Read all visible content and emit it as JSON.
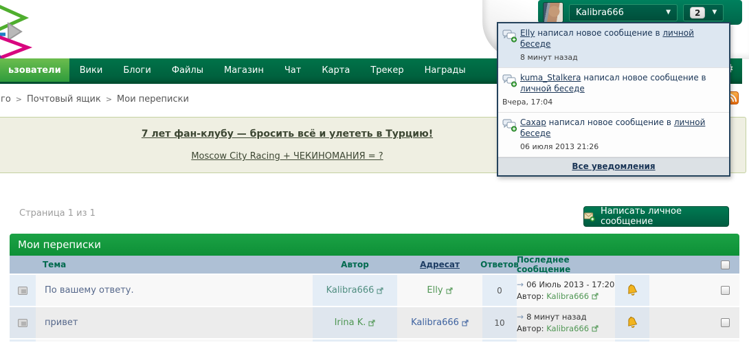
{
  "colors": {
    "nav_green": "#006a45",
    "accent_green": "#0e9037",
    "user_bar_teal": "#007455",
    "table_header_blue": "#aec0d5",
    "unread_blue": "#dde7f1",
    "link_green": "#4f9653",
    "link_blue": "#3f63a0",
    "announcement_bg": "#efefe2"
  },
  "user_bar": {
    "username": "Kalibra666",
    "notification_count": "2"
  },
  "notifications": {
    "items": [
      {
        "user": "Elly",
        "action": "написал новое сообщение в",
        "target": "личной беседе",
        "time": "8 минут назад"
      },
      {
        "user": "kuma_Stalkera",
        "action": "написал новое сообщение в",
        "target": "личной беседе",
        "time": "Вчера, 17:04"
      },
      {
        "user": "Сахар",
        "action": "написал новое сообщение в",
        "target": "личной беседе",
        "time": "06 июля 2013 21:26"
      }
    ],
    "footer": "Все уведомления"
  },
  "nav": {
    "items": [
      "ьзователи",
      "Вики",
      "Блоги",
      "Файлы",
      "Магазин",
      "Чат",
      "Карта",
      "Трекер",
      "Награды"
    ]
  },
  "breadcrumb": {
    "separator": ">",
    "parts": [
      "го",
      "Почтовый ящик",
      "Мои переписки"
    ]
  },
  "announcements": [
    "7 лет фан-клубу — бросить всё и улететь в Турцию!",
    "Moscow City Racing + ЧЕКИНОМАНИЯ = ?"
  ],
  "pagination": "Страница 1 из 1",
  "compose_button": "Написать личное сообщение",
  "table": {
    "title": "Мои переписки",
    "headers": {
      "topic": "Тема",
      "author": "Автор",
      "recipient": "Адресат",
      "replies": "Ответов",
      "last_message": "Последнее сообщение"
    },
    "rows": [
      {
        "topic": "По вашему ответу.",
        "author": "Kalibra666",
        "recipient": "Elly",
        "replies": "0",
        "last_date": "06 Июль 2013 - 17:20",
        "last_author_label": "Автор:",
        "last_author": "Kalibra666"
      },
      {
        "topic": "привет",
        "author": "Irina K.",
        "recipient": "Kalibra666",
        "replies": "10",
        "last_date": "8 минут назад",
        "last_author_label": "Автор:",
        "last_author": "Kalibra666"
      }
    ]
  }
}
